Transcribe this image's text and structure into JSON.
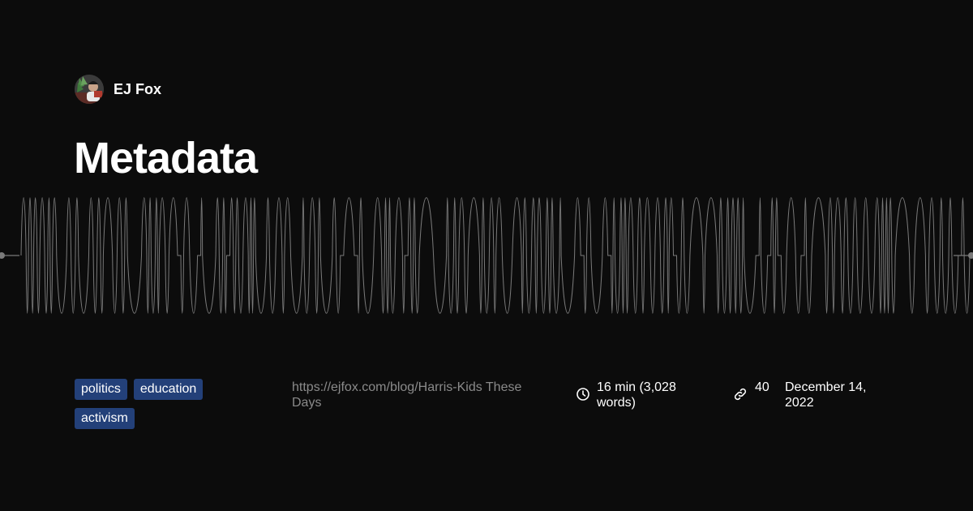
{
  "author": {
    "name": "EJ Fox",
    "avatar_icon": "author-avatar"
  },
  "post": {
    "title": "Metadata",
    "url": "https://ejfox.com/blog/Harris-Kids These Days",
    "reading_time": "16 min (3,028 words)",
    "link_count": "40",
    "date": "December 14, 2022"
  },
  "tags": [
    "politics",
    "education",
    "activism"
  ],
  "colors": {
    "background": "#0c0c0c",
    "tag_background": "#234079",
    "waveform": "#7a7a7a",
    "url_text": "#8a8a8a"
  },
  "icons": {
    "reading_time": "clock-icon",
    "links": "link-icon"
  }
}
